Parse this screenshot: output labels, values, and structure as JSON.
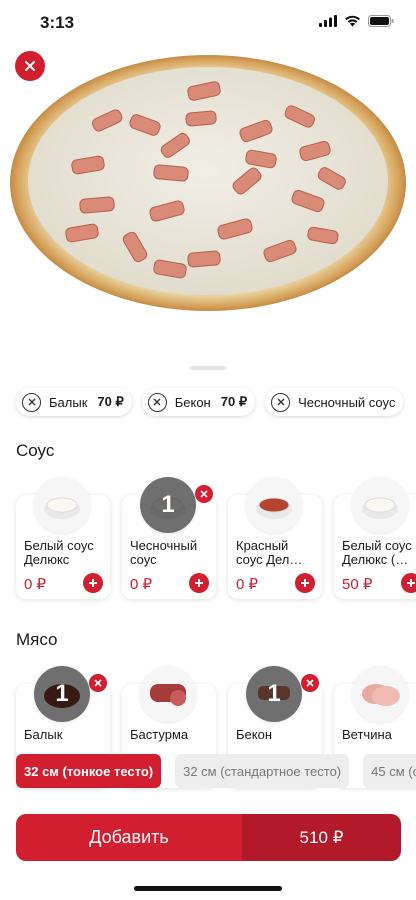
{
  "status": {
    "time": "3:13"
  },
  "chips": [
    {
      "name": "Балык",
      "price": "70 ₽"
    },
    {
      "name": "Бекон",
      "price": "70 ₽"
    },
    {
      "name": "Чесночный соус",
      "price": ""
    }
  ],
  "sauce": {
    "title": "Соус",
    "items": [
      {
        "name": "Белый соус Делюкс",
        "price": "0 ₽"
      },
      {
        "name": "Чесночный соус",
        "price": "0 ₽",
        "count": "1"
      },
      {
        "name": "Красный соус Дел…",
        "price": "0 ₽"
      },
      {
        "name": "Белый соус Делюкс (…",
        "price": "50 ₽"
      }
    ]
  },
  "meat": {
    "title": "Мясо",
    "items": [
      {
        "name": "Балык",
        "count": "1"
      },
      {
        "name": "Бастурма"
      },
      {
        "name": "Бекон",
        "count": "1"
      },
      {
        "name": "Ветчина"
      }
    ]
  },
  "sizes": [
    {
      "label": "32 см (тонкое тесто)",
      "active": true
    },
    {
      "label": "32 см (стандартное тесто)",
      "active": false
    },
    {
      "label": "45 см (с",
      "active": false
    }
  ],
  "cart": {
    "add_label": "Добавить",
    "total": "510 ₽"
  },
  "colors": {
    "accent": "#d21f2f",
    "accent_dark": "#b31a29"
  }
}
